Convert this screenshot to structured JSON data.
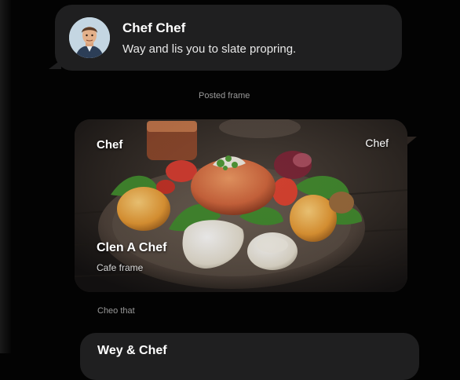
{
  "messages": [
    {
      "sender": "Chef Chef",
      "text": "Way and lis you to slate propring.",
      "avatar_icon": "chef-avatar-icon"
    }
  ],
  "timestamps": [
    "Posted frame",
    "Cheo that"
  ],
  "image_card": {
    "label_left": "Chef",
    "label_right": "Chef",
    "caption_title": "Clen A Chef",
    "caption_subtitle": "Cafe frame"
  },
  "bottom_message": {
    "title": "Wey & Chef"
  },
  "colors": {
    "background": "#030303",
    "bubble": "#1f1f20",
    "text": "#f2f2f2",
    "muted": "#9a9a9a"
  }
}
